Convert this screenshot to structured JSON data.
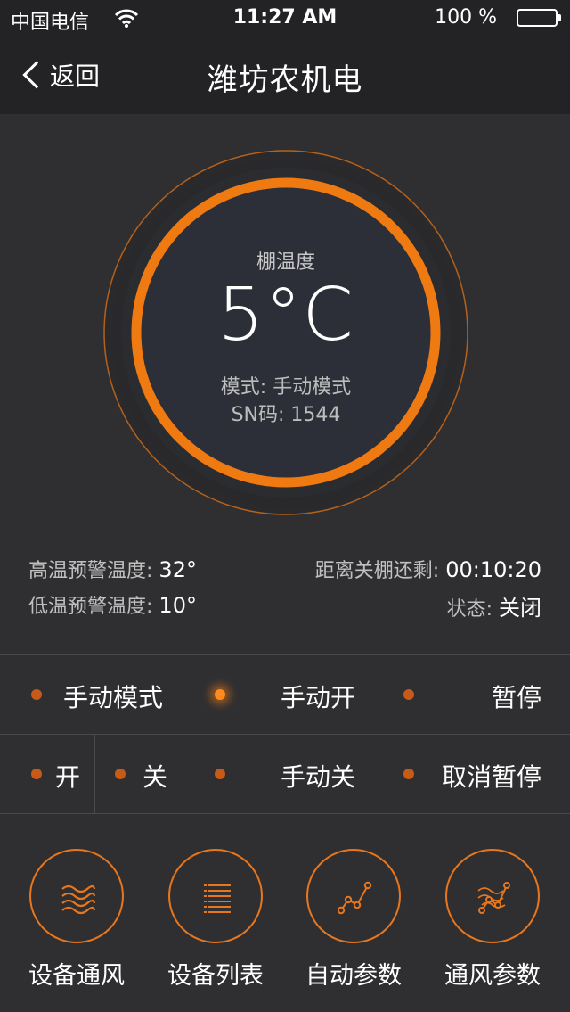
{
  "status_bar": {
    "carrier": "中国电信",
    "time": "11:27 AM",
    "battery": "100 %"
  },
  "nav": {
    "back_label": "返回",
    "title": "潍坊农机电"
  },
  "dial": {
    "label": "棚温度",
    "value": "5°C",
    "mode": "模式: 手动模式",
    "sn": "SN码: 1544",
    "accent_color": "#f07a12"
  },
  "info": {
    "high_alert_label": "高温预警温度:",
    "high_alert_value": "32°",
    "low_alert_label": "低温预警温度:",
    "low_alert_value": "10°",
    "countdown_label": "距离关棚还剩:",
    "countdown_value": "00:10:20",
    "status_label": "状态:",
    "status_value": "关闭"
  },
  "controls": {
    "manual_mode": "手动模式",
    "manual_open": "手动开",
    "pause": "暂停",
    "open": "开",
    "close": "关",
    "manual_close": "手动关",
    "cancel_pause": "取消暂停"
  },
  "footer": {
    "items": [
      {
        "label": "设备通风",
        "icon": "wind-waves-icon"
      },
      {
        "label": "设备列表",
        "icon": "list-icon"
      },
      {
        "label": "自动参数",
        "icon": "line-chart-icon"
      },
      {
        "label": "通风参数",
        "icon": "wind-chart-icon"
      }
    ]
  }
}
